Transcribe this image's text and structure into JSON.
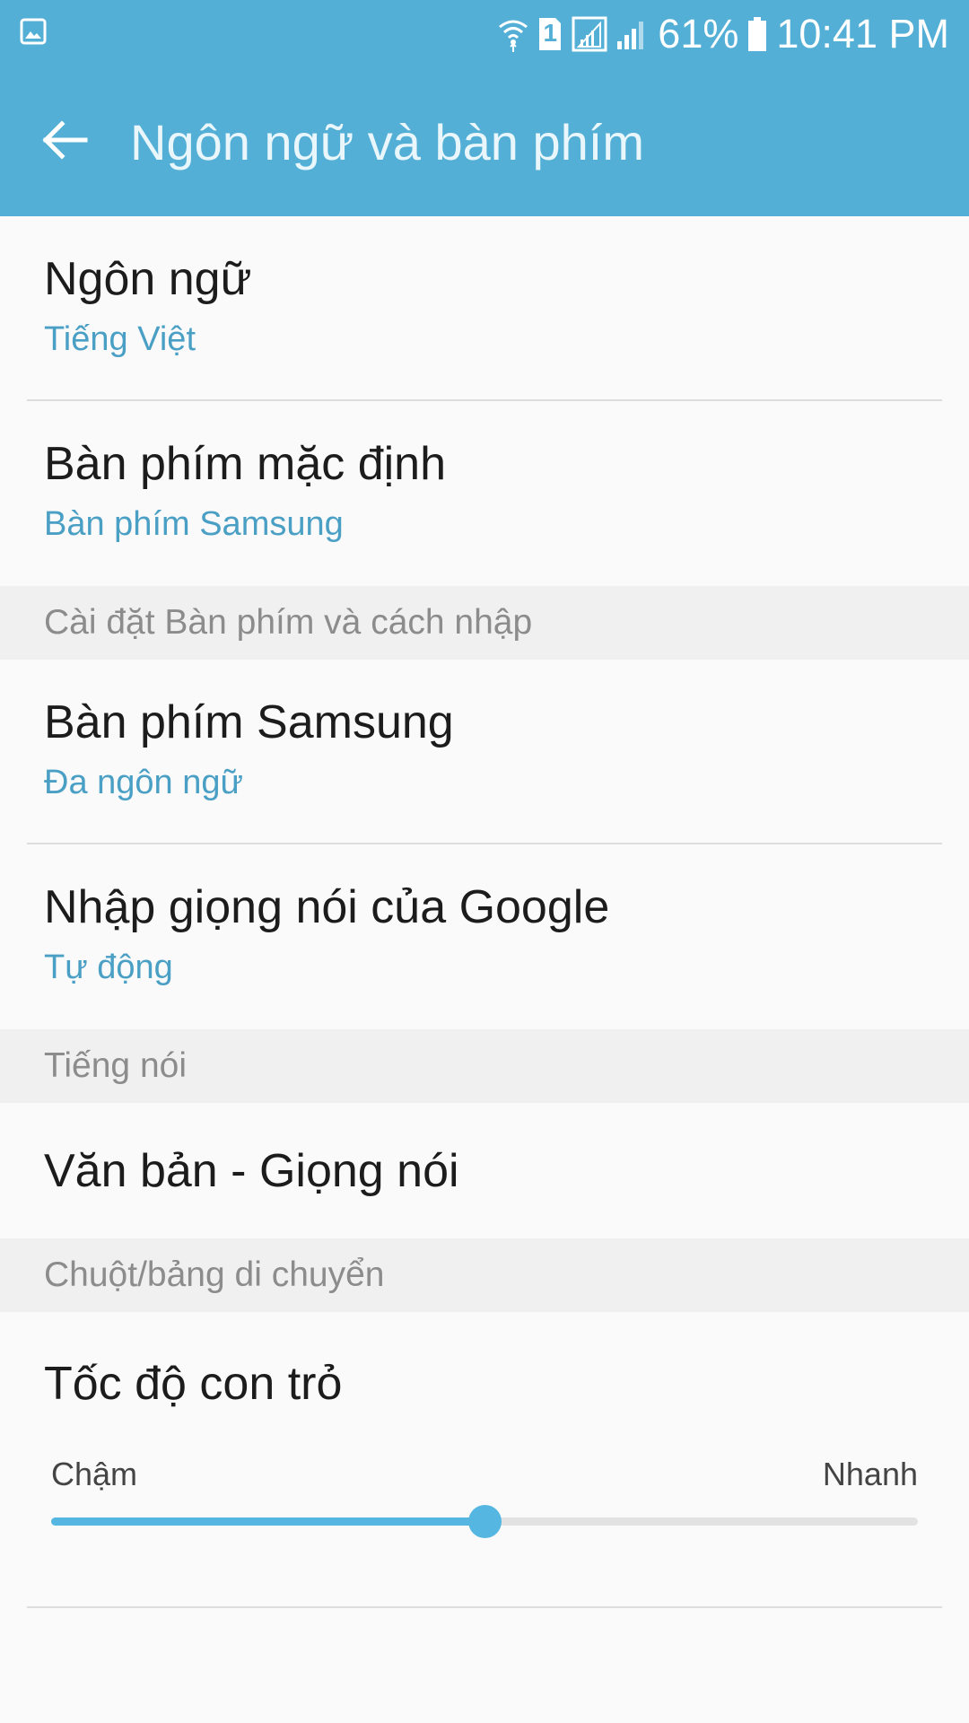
{
  "status_bar": {
    "battery": "61%",
    "time": "10:41 PM",
    "sim_badge": "1",
    "icons": [
      "gallery-icon",
      "wifi-icon",
      "sim-icon",
      "signal-sim1-icon",
      "signal-icon",
      "battery-icon"
    ]
  },
  "app_bar": {
    "title": "Ngôn ngữ và bàn phím",
    "back_icon": "arrow-left-icon"
  },
  "items": {
    "language": {
      "title": "Ngôn ngữ",
      "subtitle": "Tiếng Việt"
    },
    "default_keyboard": {
      "title": "Bàn phím mặc định",
      "subtitle": "Bàn phím Samsung"
    }
  },
  "sections": {
    "keyboard_input": {
      "header": "Cài đặt Bàn phím và cách nhập",
      "items": [
        {
          "title": "Bàn phím Samsung",
          "subtitle": "Đa ngôn ngữ"
        },
        {
          "title": "Nhập giọng nói của Google",
          "subtitle": "Tự động"
        }
      ]
    },
    "speech": {
      "header": "Tiếng nói",
      "items": [
        {
          "title": "Văn bản - Giọng nói"
        }
      ]
    },
    "mouse_trackpad": {
      "header": "Chuột/bảng di chuyển",
      "pointer_speed": {
        "title": "Tốc độ con trỏ",
        "min_label": "Chậm",
        "max_label": "Nhanh",
        "value_fraction": 0.5
      }
    }
  },
  "colors": {
    "accent": "#53afd6",
    "subtitle": "#4a9fc5",
    "slider": "#55b7e1"
  }
}
